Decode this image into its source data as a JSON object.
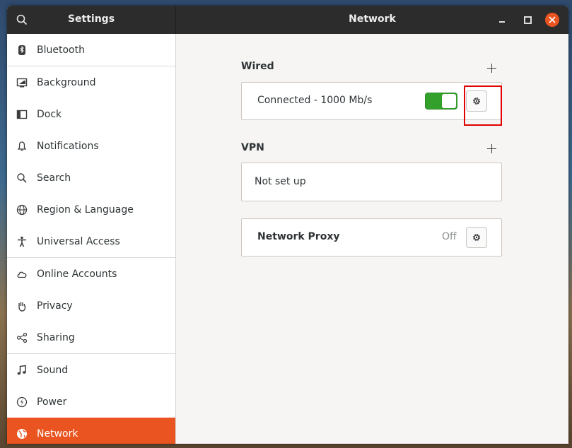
{
  "header": {
    "settings_title": "Settings",
    "network_title": "Network"
  },
  "sidebar": {
    "items": [
      {
        "label": "Bluetooth",
        "icon": "bluetooth-icon"
      },
      {
        "label": "Background",
        "icon": "background-icon"
      },
      {
        "label": "Dock",
        "icon": "dock-icon"
      },
      {
        "label": "Notifications",
        "icon": "bell-icon"
      },
      {
        "label": "Search",
        "icon": "search-icon"
      },
      {
        "label": "Region & Language",
        "icon": "globe-icon"
      },
      {
        "label": "Universal Access",
        "icon": "accessibility-icon"
      },
      {
        "label": "Online Accounts",
        "icon": "cloud-icon"
      },
      {
        "label": "Privacy",
        "icon": "hand-icon"
      },
      {
        "label": "Sharing",
        "icon": "share-icon"
      },
      {
        "label": "Sound",
        "icon": "music-note-icon"
      },
      {
        "label": "Power",
        "icon": "power-icon"
      },
      {
        "label": "Network",
        "icon": "network-globe-icon",
        "active": true
      }
    ]
  },
  "wired": {
    "title": "Wired",
    "status": "Connected - 1000 Mb/s",
    "enabled": true
  },
  "vpn": {
    "title": "VPN",
    "status": "Not set up"
  },
  "proxy": {
    "label": "Network Proxy",
    "state": "Off"
  },
  "colors": {
    "accent": "#e95420",
    "switch_on": "#33a02c",
    "highlight": "#e00000"
  }
}
